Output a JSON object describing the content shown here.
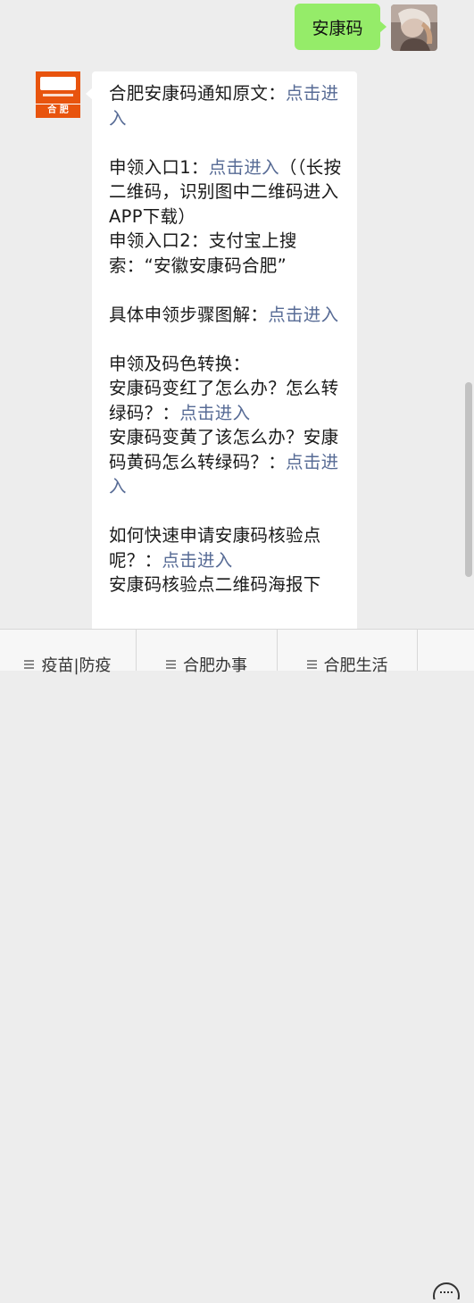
{
  "user_message": {
    "text": "安康码"
  },
  "bot": {
    "logo_text": "合 肥"
  },
  "message": {
    "p1": "合肥安康码通知原文：",
    "p1_link": "点击进入",
    "p2a": "申领入口1：",
    "p2a_link": "点击进入",
    "p2a_tail": "（（长按二维码，识别图中二维码进入APP下载）",
    "p2b": "申领入口2：支付宝上搜索：“安徽安康码合肥”",
    "p3": "具体申领步骤图解：",
    "p3_link": "点击进入",
    "p4": "申领及码色转换：",
    "p4a": "安康码变红了怎么办？怎么转绿码？：",
    "p4a_link": "点击进入",
    "p4b": "安康码变黄了该怎么办？安康码黄码怎么转绿码？：",
    "p4b_link": "点击进入",
    "p5": "如何快速申请安康码核验点呢？：",
    "p5_link": "点击进入",
    "p6": "安康码核验点二维码海报下"
  },
  "tabs": [
    {
      "label": "疫苗|防疫"
    },
    {
      "label": "合肥办事"
    },
    {
      "label": "合肥生活"
    }
  ],
  "colors": {
    "link": "#576b95",
    "user_bubble": "#95ec69",
    "brand_orange": "#e8540e"
  }
}
